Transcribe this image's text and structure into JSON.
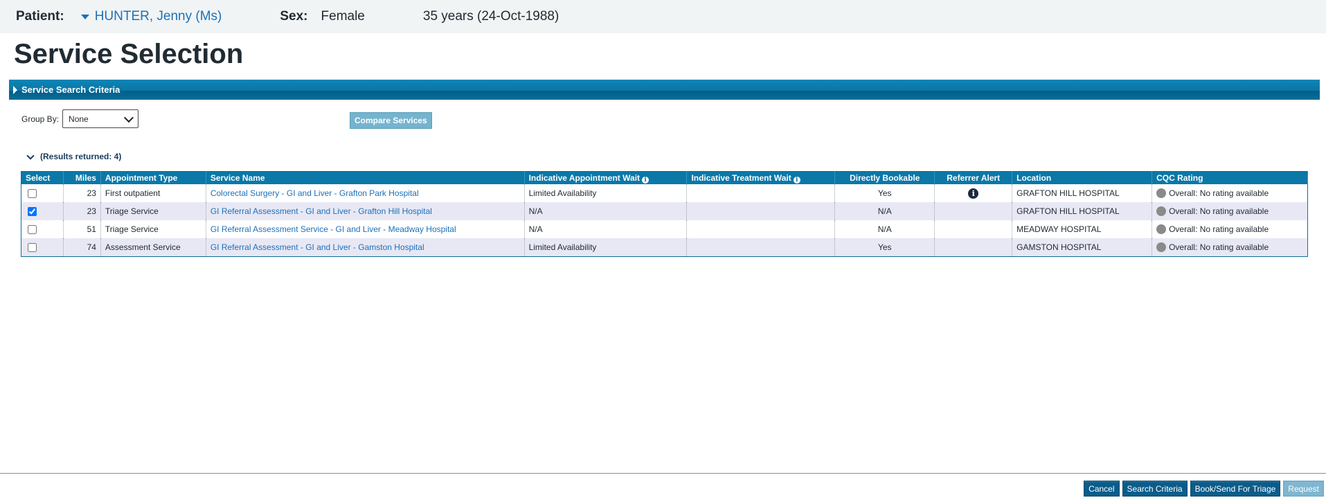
{
  "patient": {
    "label": "Patient:",
    "name": "HUNTER, Jenny (Ms)",
    "sex_label": "Sex:",
    "sex": "Female",
    "age_dob": "35 years (24-Oct-1988)"
  },
  "page_title": "Service Selection",
  "criteria": {
    "label": "Service Search Criteria"
  },
  "group_by": {
    "label": "Group By:",
    "value": "None"
  },
  "compare_button": "Compare Services",
  "results_label": "(Results returned: 4)",
  "table": {
    "headers": {
      "select": "Select",
      "miles": "Miles",
      "appt_type": "Appointment Type",
      "service_name": "Service Name",
      "appt_wait": "Indicative Appointment Wait",
      "treatment_wait": "Indicative Treatment Wait",
      "bookable": "Directly Bookable",
      "alert": "Referrer Alert",
      "location": "Location",
      "cqc": "CQC Rating"
    },
    "rows": [
      {
        "checked": false,
        "miles": "23",
        "appt_type": "First outpatient",
        "service_name": "Colorectal Surgery - GI and Liver - Grafton Park Hospital",
        "appt_wait": "Limited Availability",
        "treatment_wait": "",
        "bookable": "Yes",
        "alert": true,
        "location": "GRAFTON HILL HOSPITAL",
        "cqc": "Overall: No rating available"
      },
      {
        "checked": true,
        "miles": "23",
        "appt_type": "Triage Service",
        "service_name": "GI Referral Assessment - GI and Liver - Grafton Hill Hospital",
        "appt_wait": "N/A",
        "treatment_wait": "",
        "bookable": "N/A",
        "alert": false,
        "location": "GRAFTON HILL HOSPITAL",
        "cqc": "Overall: No rating available"
      },
      {
        "checked": false,
        "miles": "51",
        "appt_type": "Triage Service",
        "service_name": "GI Referral Assessment Service - GI and Liver - Meadway Hospital",
        "appt_wait": "N/A",
        "treatment_wait": "",
        "bookable": "N/A",
        "alert": false,
        "location": "MEADWAY HOSPITAL",
        "cqc": "Overall: No rating available"
      },
      {
        "checked": false,
        "miles": "74",
        "appt_type": "Assessment Service",
        "service_name": "GI Referral Assessment - GI and Liver - Gamston Hospital",
        "appt_wait": "Limited Availability",
        "treatment_wait": "",
        "bookable": "Yes",
        "alert": false,
        "location": "GAMSTON HOSPITAL",
        "cqc": "Overall: No rating available"
      }
    ]
  },
  "footer": {
    "cancel": "Cancel",
    "search_criteria": "Search Criteria",
    "book_send": "Book/Send For Triage",
    "request": "Request"
  },
  "colors": {
    "header_blue": "#0b78a8",
    "link_blue": "#1d70b8",
    "row_alt": "#e8e8f5"
  }
}
